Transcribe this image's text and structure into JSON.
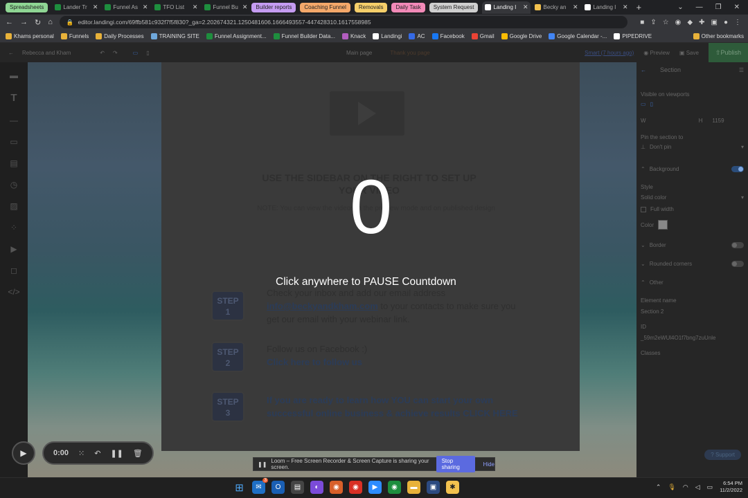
{
  "browser": {
    "tab_groups": [
      {
        "label": "Spreadsheets",
        "color": "#8fd694"
      },
      {
        "label": "Builder reports",
        "color": "#c59cf2"
      },
      {
        "label": "Coaching Funnel",
        "color": "#f4a86a"
      },
      {
        "label": "Removals",
        "color": "#f6cf6a"
      },
      {
        "label": "Daily Task",
        "color": "#f28ab8"
      },
      {
        "label": "System Request",
        "color": "#cfcfcf"
      }
    ],
    "tabs": [
      "Lander Tr",
      "Funnel As",
      "TFO List",
      "Funnel Bu",
      "Landing I",
      "Becky an",
      "Landing I"
    ],
    "url": "editor.landingi.com/69ffb581c932f7f5f830?_ga=2.202674321.1250481606.1666493557-447428310.1617558985",
    "bookmarks": [
      "Khams personal",
      "Funnels",
      "Daily Processes",
      "TRAINING SITE",
      "Funnel Assignment...",
      "Funnel Builder Data...",
      "Knack",
      "Landingi",
      "AC",
      "Facebook",
      "Gmail",
      "Google Drive",
      "Google Calendar -...",
      "PIPEDRIVE"
    ],
    "other_bookmarks": "Other bookmarks"
  },
  "editor": {
    "project_name": "Rebecca and Kham",
    "page_tabs": [
      "Main page",
      "Thank you page"
    ],
    "smart_sections": "Smart (7 hours ago)",
    "preview_label": "Preview",
    "save_label": "Save",
    "publish_label": "Publish"
  },
  "canvas": {
    "placeholder_title": "USE THE SIDEBAR ON THE RIGHT TO SET UP YOUR VIDEO",
    "placeholder_note": "NOTE: You can view the videos in the preview mode and on published design",
    "steps": [
      {
        "badge_top": "STEP",
        "badge_num": "1",
        "line1": "Check your inbox and add our email address",
        "email": "info@beckyandkham.com",
        "line2": " to your contacts to make sure you get our email with your webinar link."
      },
      {
        "badge_top": "STEP",
        "badge_num": "2",
        "line1": "Follow us on Facebook :)",
        "link": "Click here to follow us"
      },
      {
        "badge_top": "STEP",
        "badge_num": "3",
        "cta": "If you are ready to learn how YOU can start your own successful online business & achieve results CLICK HERE"
      }
    ]
  },
  "overlay": {
    "countdown": "0",
    "pause_message": "Click anywhere to PAUSE Countdown"
  },
  "right_panel": {
    "title": "Section",
    "visible_on": "Visible on viewports",
    "w_label": "W",
    "h_label": "H",
    "h_value": "1159",
    "pin_label": "Pin the section to",
    "pin_value": "Don't pin",
    "background": "Background",
    "style_label": "Style",
    "style_value": "Solid color",
    "full_width": "Full width",
    "color_label": "Color",
    "border": "Border",
    "rounded": "Rounded corners",
    "other": "Other",
    "element_name_label": "Element name",
    "element_name_value": "Section 2",
    "id_label": "ID",
    "id_value": "_59m2eWUl4O1f7bng7zuUnle",
    "classes_label": "Classes",
    "support": "Support"
  },
  "recorder": {
    "time": "0:00"
  },
  "loom": {
    "message": "Loom – Free Screen Recorder & Screen Capture is sharing your screen.",
    "stop": "Stop sharing",
    "hide": "Hide"
  },
  "taskbar": {
    "time": "6:54 PM",
    "date": "11/2/2022",
    "notification_badge": "3"
  }
}
